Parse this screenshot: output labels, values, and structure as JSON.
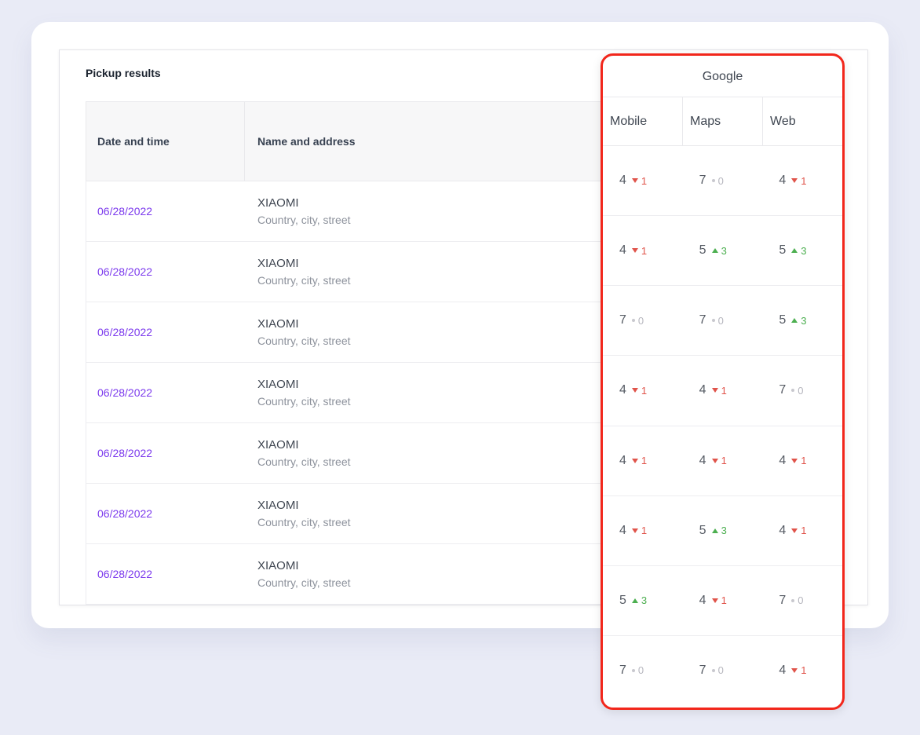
{
  "card": {
    "title": "Pickup results"
  },
  "table": {
    "headers": {
      "date": "Date and time",
      "name": "Name and address"
    },
    "rows": [
      {
        "date": "06/28/2022",
        "name": "XIAOMI",
        "address": "Country, city, street"
      },
      {
        "date": "06/28/2022",
        "name": "XIAOMI",
        "address": "Country, city, street"
      },
      {
        "date": "06/28/2022",
        "name": "XIAOMI",
        "address": "Country, city, street"
      },
      {
        "date": "06/28/2022",
        "name": "XIAOMI",
        "address": "Country, city, street"
      },
      {
        "date": "06/28/2022",
        "name": "XIAOMI",
        "address": "Country, city, street"
      },
      {
        "date": "06/28/2022",
        "name": "XIAOMI",
        "address": "Country, city, street"
      },
      {
        "date": "06/28/2022",
        "name": "XIAOMI",
        "address": "Country, city, street"
      }
    ]
  },
  "google": {
    "title": "Google",
    "columns": [
      "Mobile",
      "Maps",
      "Web"
    ],
    "rows": [
      [
        {
          "value": "4",
          "delta": "1",
          "trend": "down"
        },
        {
          "value": "7",
          "delta": "0",
          "trend": "flat"
        },
        {
          "value": "4",
          "delta": "1",
          "trend": "down"
        }
      ],
      [
        {
          "value": "4",
          "delta": "1",
          "trend": "down"
        },
        {
          "value": "5",
          "delta": "3",
          "trend": "up"
        },
        {
          "value": "5",
          "delta": "3",
          "trend": "up"
        }
      ],
      [
        {
          "value": "7",
          "delta": "0",
          "trend": "flat"
        },
        {
          "value": "7",
          "delta": "0",
          "trend": "flat"
        },
        {
          "value": "5",
          "delta": "3",
          "trend": "up"
        }
      ],
      [
        {
          "value": "4",
          "delta": "1",
          "trend": "down"
        },
        {
          "value": "4",
          "delta": "1",
          "trend": "down"
        },
        {
          "value": "7",
          "delta": "0",
          "trend": "flat"
        }
      ],
      [
        {
          "value": "4",
          "delta": "1",
          "trend": "down"
        },
        {
          "value": "4",
          "delta": "1",
          "trend": "down"
        },
        {
          "value": "4",
          "delta": "1",
          "trend": "down"
        }
      ],
      [
        {
          "value": "4",
          "delta": "1",
          "trend": "down"
        },
        {
          "value": "5",
          "delta": "3",
          "trend": "up"
        },
        {
          "value": "4",
          "delta": "1",
          "trend": "down"
        }
      ],
      [
        {
          "value": "5",
          "delta": "3",
          "trend": "up"
        },
        {
          "value": "4",
          "delta": "1",
          "trend": "down"
        },
        {
          "value": "7",
          "delta": "0",
          "trend": "flat"
        }
      ],
      [
        {
          "value": "7",
          "delta": "0",
          "trend": "flat"
        },
        {
          "value": "7",
          "delta": "0",
          "trend": "flat"
        },
        {
          "value": "4",
          "delta": "1",
          "trend": "down"
        }
      ]
    ]
  },
  "colors": {
    "highlight_border": "#f2261b",
    "date_link": "#7c3aed",
    "trend_up": "#4caf50",
    "trend_down": "#e0534a",
    "trend_flat": "#c8c8ce"
  }
}
